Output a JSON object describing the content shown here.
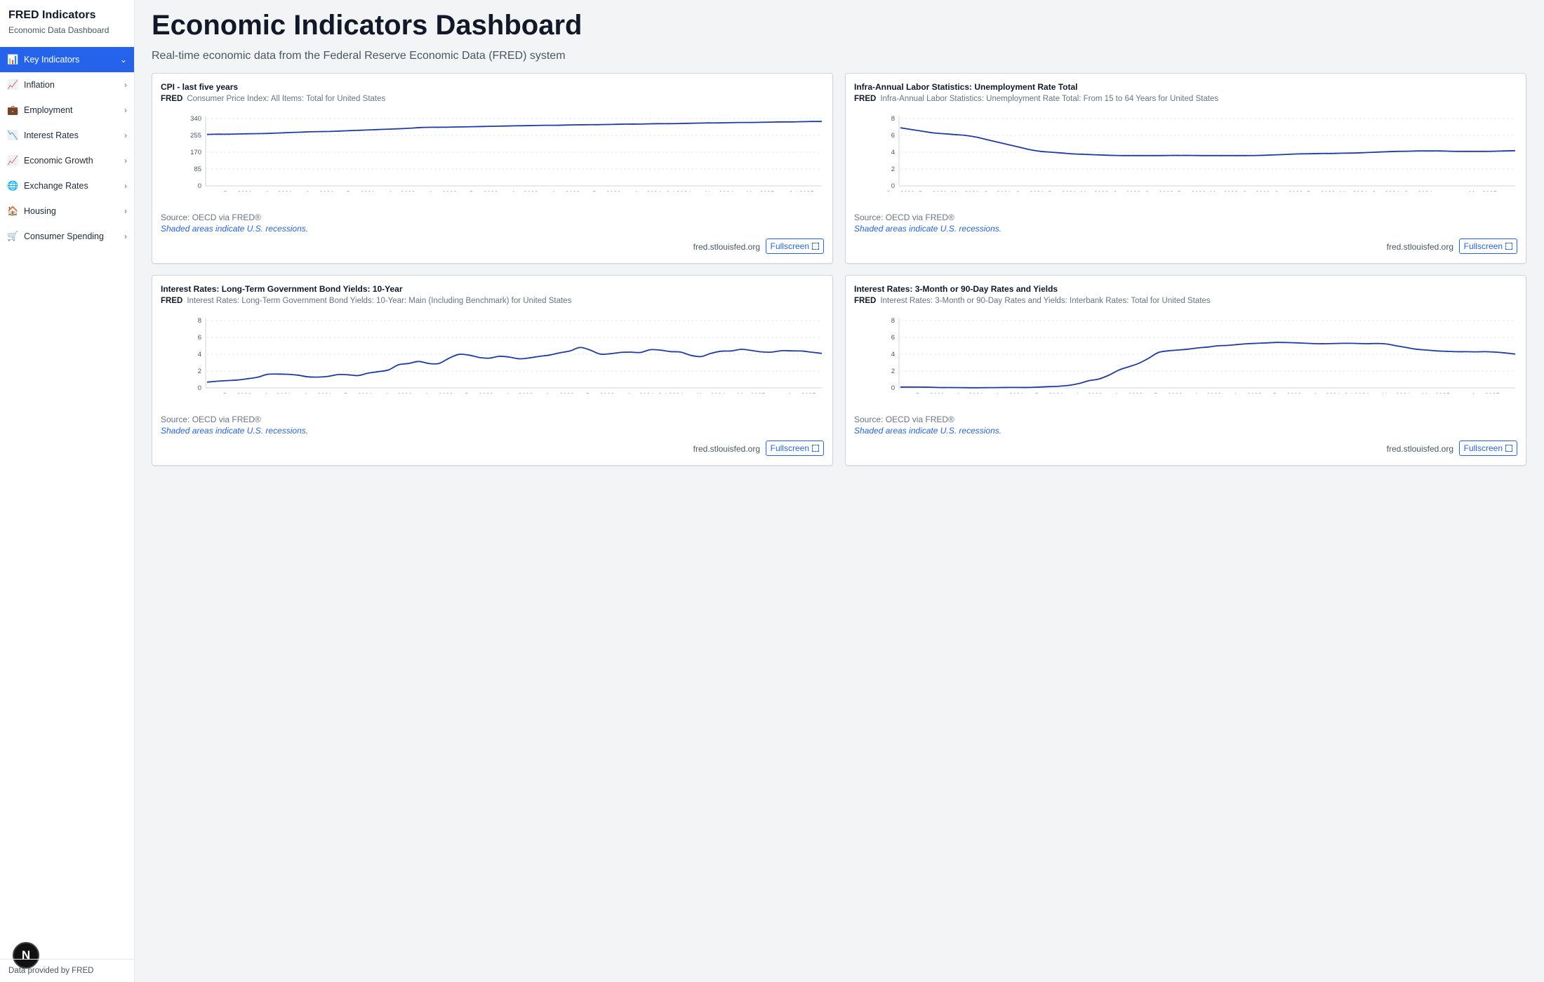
{
  "sidebar": {
    "title": "FRED Indicators",
    "subtitle": "Economic Data Dashboard",
    "items": [
      {
        "label": "Key Indicators",
        "icon": "bar-chart-icon",
        "glyph": "📊",
        "active": true
      },
      {
        "label": "Inflation",
        "icon": "trending-up-icon",
        "glyph": "📈",
        "active": false
      },
      {
        "label": "Employment",
        "icon": "briefcase-icon",
        "glyph": "💼",
        "active": false
      },
      {
        "label": "Interest Rates",
        "icon": "trending-down-icon",
        "glyph": "📉",
        "active": false
      },
      {
        "label": "Economic Growth",
        "icon": "trending-up-icon",
        "glyph": "📈",
        "active": false
      },
      {
        "label": "Exchange Rates",
        "icon": "globe-icon",
        "glyph": "🌐",
        "active": false
      },
      {
        "label": "Housing",
        "icon": "house-icon",
        "glyph": "🏠",
        "active": false
      },
      {
        "label": "Consumer Spending",
        "icon": "shopping-cart-icon",
        "glyph": "🛒",
        "active": false
      }
    ],
    "footer": "Data provided by FRED",
    "badge": "N"
  },
  "header": {
    "title": "Economic Indicators Dashboard",
    "subtitle": "Real-time economic data from the Federal Reserve Economic Data (FRED) system"
  },
  "colors": {
    "accent": "#2563eb",
    "line": "#1e3aa8",
    "grid": "#e5e7eb"
  },
  "cards": [
    {
      "title": "CPI - last five years",
      "logo": "FRED",
      "series_title": "Consumer Price Index: All Items: Total for United States",
      "source": "Source: OECD via FRED®",
      "note": "Shaded areas indicate U.S. recessions.",
      "link": "fred.stlouisfed.org",
      "button": "Fullscreen"
    },
    {
      "title": "Infra-Annual Labor Statistics: Unemployment Rate Total",
      "logo": "FRED",
      "series_title": "Infra-Annual Labor Statistics: Unemployment Rate Total: From 15 to 64 Years for United States",
      "source": "Source: OECD via FRED®",
      "note": "Shaded areas indicate U.S. recessions.",
      "link": "fred.stlouisfed.org",
      "button": "Fullscreen"
    },
    {
      "title": "Interest Rates: Long-Term Government Bond Yields: 10-Year",
      "logo": "FRED",
      "series_title": "Interest Rates: Long-Term Government Bond Yields: 10-Year: Main (Including Benchmark) for United States",
      "source": "Source: OECD via FRED®",
      "note": "Shaded areas indicate U.S. recessions.",
      "link": "fred.stlouisfed.org",
      "button": "Fullscreen"
    },
    {
      "title": "Interest Rates: 3-Month or 90-Day Rates and Yields",
      "logo": "FRED",
      "series_title": "Interest Rates: 3-Month or 90-Day Rates and Yields: Interbank Rates: Total for United States",
      "source": "Source: OECD via FRED®",
      "note": "Shaded areas indicate U.S. recessions.",
      "link": "fred.stlouisfed.org",
      "button": "Fullscreen"
    }
  ],
  "chart_data": [
    {
      "type": "line",
      "title": "CPI - last five years",
      "x_start": "2020-09",
      "x_step": "month",
      "x_tick_labels": [
        "Dec 2020",
        "Apr 2021",
        "Aug 2021",
        "Dec 2021",
        "Apr 2022",
        "Aug 2022",
        "Dec 2022",
        "Apr 2023",
        "Aug 2023",
        "Dec 2023",
        "Apr 2024",
        "Jul 2024",
        "Nov 2024",
        "Mar 2025",
        "Jul 2025"
      ],
      "y_ticks": [
        0,
        85,
        170,
        255,
        340
      ],
      "ylim": [
        0,
        340
      ],
      "grid": true,
      "series": [
        {
          "values": [
            260,
            261,
            261,
            262,
            263,
            264,
            265,
            267,
            269,
            271,
            273,
            274,
            275,
            277,
            279,
            281,
            283,
            285,
            287,
            289,
            292,
            295,
            296,
            296,
            297,
            298,
            299,
            300,
            301,
            302,
            303,
            304,
            305,
            306,
            306,
            307,
            308,
            309,
            309,
            310,
            311,
            312,
            312,
            313,
            314,
            314,
            315,
            316,
            317,
            318,
            318,
            319,
            320,
            320,
            321,
            322,
            323,
            323,
            324,
            325,
            325
          ]
        }
      ]
    },
    {
      "type": "line",
      "title": "Infra-Annual Labor Statistics: Unemployment Rate Total",
      "x_start": "2020-09",
      "x_step": "month",
      "x_tick_labels": [
        "Sep 2020",
        "Dec 2020",
        "Mar 2021",
        "Jun 2021",
        "Sep 2021",
        "Dec 2021",
        "Mar 2022",
        "Jun 2022",
        "Sep 2022",
        "Dec 2022",
        "Mar 2023",
        "Jun 2023",
        "Sep 2023",
        "Dec 2023",
        "Mar 2024",
        "Jun 2024",
        "Sep 2024",
        "Mar 2025"
      ],
      "y_ticks": [
        0,
        2,
        4,
        6,
        8
      ],
      "ylim": [
        0,
        8
      ],
      "grid": true,
      "series": [
        {
          "values": [
            6.9,
            6.7,
            6.5,
            6.3,
            6.2,
            6.1,
            6.0,
            5.8,
            5.5,
            5.2,
            4.9,
            4.6,
            4.3,
            4.1,
            4.0,
            3.9,
            3.8,
            3.75,
            3.7,
            3.65,
            3.62,
            3.6,
            3.6,
            3.6,
            3.6,
            3.62,
            3.62,
            3.62,
            3.6,
            3.6,
            3.6,
            3.6,
            3.6,
            3.62,
            3.65,
            3.7,
            3.75,
            3.8,
            3.82,
            3.85,
            3.85,
            3.88,
            3.9,
            3.95,
            4.0,
            4.05,
            4.1,
            4.12,
            4.15,
            4.15,
            4.15,
            4.12,
            4.1,
            4.1,
            4.1,
            4.12,
            4.15,
            4.18
          ]
        }
      ]
    },
    {
      "type": "line",
      "title": "Interest Rates: Long-Term Government Bond Yields: 10-Year",
      "x_start": "2020-09",
      "x_step": "month",
      "x_tick_labels": [
        "Dec 2020",
        "Apr 2021",
        "Aug 2021",
        "Dec 2021",
        "Apr 2022",
        "Aug 2022",
        "Dec 2022",
        "Apr 2023",
        "Aug 2023",
        "Dec 2023",
        "Apr 2024",
        "Jul 2024",
        "Nov 2024",
        "Mar 2025",
        "Aug 2025"
      ],
      "y_ticks": [
        0,
        2,
        4,
        6,
        8
      ],
      "ylim": [
        0,
        8
      ],
      "grid": true,
      "series": [
        {
          "values": [
            0.68,
            0.79,
            0.87,
            0.93,
            1.08,
            1.26,
            1.61,
            1.64,
            1.62,
            1.52,
            1.32,
            1.28,
            1.37,
            1.58,
            1.56,
            1.47,
            1.76,
            1.93,
            2.13,
            2.75,
            2.9,
            3.14,
            2.9,
            2.9,
            3.52,
            3.98,
            3.89,
            3.62,
            3.53,
            3.75,
            3.66,
            3.46,
            3.57,
            3.75,
            3.9,
            4.17,
            4.38,
            4.8,
            4.5,
            4.02,
            4.06,
            4.21,
            4.25,
            4.21,
            4.54,
            4.48,
            4.31,
            4.25,
            3.87,
            3.72,
            4.1,
            4.36,
            4.39,
            4.58,
            4.45,
            4.28,
            4.25,
            4.42,
            4.4,
            4.38,
            4.24,
            4.1
          ]
        }
      ]
    },
    {
      "type": "line",
      "title": "Interest Rates: 3-Month or 90-Day Rates and Yields",
      "x_start": "2020-09",
      "x_step": "month",
      "x_tick_labels": [
        "Dec 2020",
        "Apr 2021",
        "Aug 2021",
        "Dec 2021",
        "Apr 2022",
        "Aug 2022",
        "Dec 2022",
        "Apr 2023",
        "Aug 2023",
        "Dec 2023",
        "Apr 2024",
        "Jul 2024",
        "Nov 2024",
        "Mar 2025",
        "Aug 2025"
      ],
      "y_ticks": [
        0,
        2,
        4,
        6,
        8
      ],
      "ylim": [
        0,
        8
      ],
      "grid": true,
      "series": [
        {
          "values": [
            0.1,
            0.1,
            0.09,
            0.08,
            0.04,
            0.04,
            0.03,
            0.02,
            0.02,
            0.03,
            0.04,
            0.05,
            0.05,
            0.05,
            0.1,
            0.15,
            0.2,
            0.3,
            0.52,
            0.85,
            1.05,
            1.5,
            2.1,
            2.5,
            2.9,
            3.5,
            4.2,
            4.4,
            4.5,
            4.6,
            4.75,
            4.85,
            5.0,
            5.05,
            5.15,
            5.25,
            5.3,
            5.35,
            5.4,
            5.38,
            5.35,
            5.3,
            5.25,
            5.25,
            5.28,
            5.3,
            5.28,
            5.25,
            5.28,
            5.22,
            5.0,
            4.8,
            4.6,
            4.5,
            4.4,
            4.35,
            4.3,
            4.3,
            4.28,
            4.3,
            4.25,
            4.15,
            4.02
          ]
        }
      ]
    }
  ]
}
